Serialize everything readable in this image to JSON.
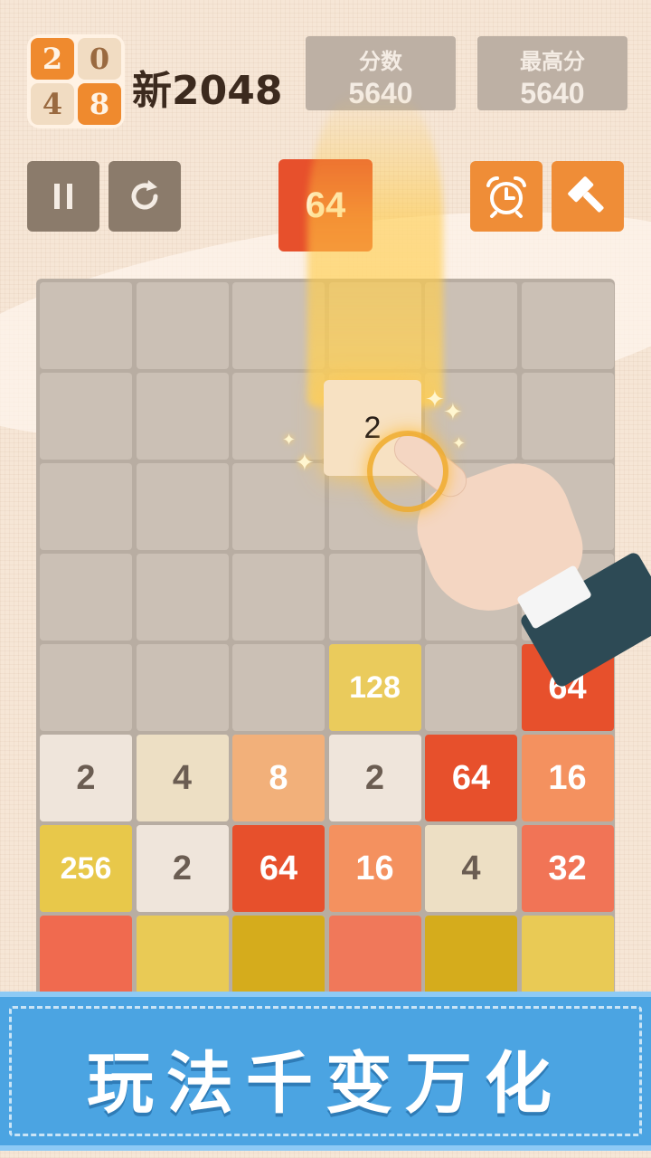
{
  "app": {
    "title": "新2048",
    "logo_digits": [
      "2",
      "0",
      "4",
      "8"
    ]
  },
  "scores": {
    "score_label": "分数",
    "score_value": "5640",
    "best_label": "最高分",
    "best_value": "5640"
  },
  "controls": {
    "pause_icon": "pause-icon",
    "restart_icon": "restart-icon",
    "alarm_icon": "alarm-clock-icon",
    "hammer_icon": "hammer-icon"
  },
  "next_tile": "64",
  "falling_tile": "2",
  "board": {
    "columns": 6,
    "rows": 8,
    "tiles": [
      {
        "row": 4,
        "col": 3,
        "value": "128",
        "color": "#eacb5c",
        "text": "#ffffff"
      },
      {
        "row": 4,
        "col": 5,
        "value": "64",
        "color": "#e7502c",
        "text": "#ffffff"
      },
      {
        "row": 5,
        "col": 0,
        "value": "2",
        "color": "#efe5db",
        "text": "#6b5d52"
      },
      {
        "row": 5,
        "col": 1,
        "value": "4",
        "color": "#eddfc4",
        "text": "#6b5d52"
      },
      {
        "row": 5,
        "col": 2,
        "value": "8",
        "color": "#f2b07a",
        "text": "#ffffff"
      },
      {
        "row": 5,
        "col": 3,
        "value": "2",
        "color": "#efe5db",
        "text": "#6b5d52"
      },
      {
        "row": 5,
        "col": 4,
        "value": "64",
        "color": "#e7502c",
        "text": "#ffffff"
      },
      {
        "row": 5,
        "col": 5,
        "value": "16",
        "color": "#f4915f",
        "text": "#ffffff"
      },
      {
        "row": 6,
        "col": 0,
        "value": "256",
        "color": "#e8c84a",
        "text": "#ffffff"
      },
      {
        "row": 6,
        "col": 1,
        "value": "2",
        "color": "#efe5db",
        "text": "#6b5d52"
      },
      {
        "row": 6,
        "col": 2,
        "value": "64",
        "color": "#e7502c",
        "text": "#ffffff"
      },
      {
        "row": 6,
        "col": 3,
        "value": "16",
        "color": "#f4915f",
        "text": "#ffffff"
      },
      {
        "row": 6,
        "col": 4,
        "value": "4",
        "color": "#eddfc4",
        "text": "#6b5d52"
      },
      {
        "row": 6,
        "col": 5,
        "value": "32",
        "color": "#f17456",
        "text": "#ffffff"
      },
      {
        "row": 7,
        "col": 0,
        "value": "",
        "color": "#f06a4f",
        "text": "#ffffff"
      },
      {
        "row": 7,
        "col": 1,
        "value": "",
        "color": "#e9ca55",
        "text": "#ffffff"
      },
      {
        "row": 7,
        "col": 2,
        "value": "",
        "color": "#d5ac1c",
        "text": "#ffffff"
      },
      {
        "row": 7,
        "col": 3,
        "value": "",
        "color": "#f0785a",
        "text": "#ffffff"
      },
      {
        "row": 7,
        "col": 4,
        "value": "",
        "color": "#d5ac1c",
        "text": "#ffffff"
      },
      {
        "row": 7,
        "col": 5,
        "value": "",
        "color": "#e9ca55",
        "text": "#ffffff"
      }
    ]
  },
  "banner": {
    "text": "玩法千变万化"
  }
}
